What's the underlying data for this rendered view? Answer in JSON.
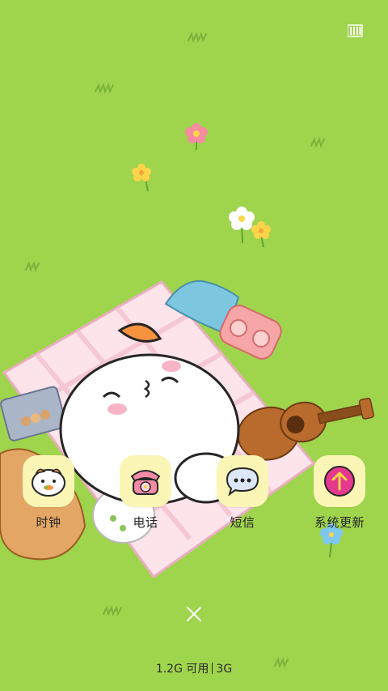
{
  "status_bar": {
    "battery_icon": "battery-icon"
  },
  "apps": [
    {
      "label": "时钟",
      "icon": "hamster-clock-icon"
    },
    {
      "label": "电话",
      "icon": "telephone-icon"
    },
    {
      "label": "短信",
      "icon": "message-bubble-icon"
    },
    {
      "label": "系统更新",
      "icon": "update-arrow-icon"
    }
  ],
  "close_icon": "close-icon",
  "memory": {
    "available": "1.2G 可用",
    "total": "3G"
  },
  "colors": {
    "background": "#9fd44d",
    "tile": "#fbf6b6",
    "update_accent": "#e5398e"
  }
}
